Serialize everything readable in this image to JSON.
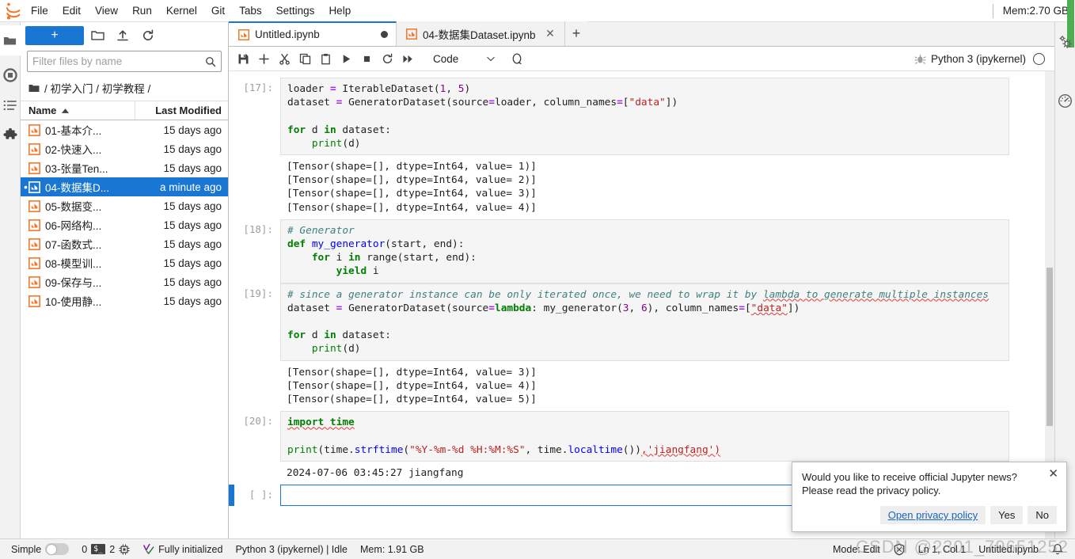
{
  "menu": {
    "logo_icon": "jupyter-logo-icon",
    "items": [
      "File",
      "Edit",
      "View",
      "Run",
      "Kernel",
      "Git",
      "Tabs",
      "Settings",
      "Help"
    ],
    "memory": "Mem:2.70 GB"
  },
  "activitybar": {
    "items": [
      {
        "name": "file-browser",
        "icon": "folder-icon",
        "active": true
      },
      {
        "name": "running-terminals-kernels",
        "icon": "stop-circle-icon",
        "active": false
      },
      {
        "name": "table-of-contents",
        "icon": "list-icon",
        "active": false
      },
      {
        "name": "extension-manager",
        "icon": "puzzle-icon",
        "active": false
      }
    ]
  },
  "rightbar": {
    "items": [
      {
        "name": "property-inspector",
        "icon": "gears-icon"
      },
      {
        "name": "debugger",
        "icon": "gauge-icon"
      }
    ]
  },
  "filebrowser": {
    "new_launcher_label": "+",
    "toolbar_icons": [
      "new-folder-icon",
      "upload-icon",
      "refresh-icon"
    ],
    "filter_placeholder": "Filter files by name",
    "filter_value": "",
    "search_icon": "search-icon",
    "breadcrumb": [
      "/",
      "初学入门",
      "/",
      "初学教程",
      "/"
    ],
    "breadcrumb_text": "/ 初学入门 / 初学教程 /",
    "columns": {
      "name": "Name",
      "modified": "Last Modified"
    },
    "sort_icon": "sort-ascending-icon",
    "files": [
      {
        "name": "01-基本介...",
        "modified": "15 days ago",
        "selected": false,
        "running": false
      },
      {
        "name": "02-快速入...",
        "modified": "15 days ago",
        "selected": false,
        "running": false
      },
      {
        "name": "03-张量Ten...",
        "modified": "15 days ago",
        "selected": false,
        "running": false
      },
      {
        "name": "04-数据集D...",
        "modified": "a minute ago",
        "selected": true,
        "running": true
      },
      {
        "name": "05-数据变...",
        "modified": "15 days ago",
        "selected": false,
        "running": false
      },
      {
        "name": "06-网络构...",
        "modified": "15 days ago",
        "selected": false,
        "running": false
      },
      {
        "name": "07-函数式...",
        "modified": "15 days ago",
        "selected": false,
        "running": false
      },
      {
        "name": "08-模型训...",
        "modified": "15 days ago",
        "selected": false,
        "running": false
      },
      {
        "name": "09-保存与...",
        "modified": "15 days ago",
        "selected": false,
        "running": false
      },
      {
        "name": "10-使用静...",
        "modified": "15 days ago",
        "selected": false,
        "running": false
      }
    ]
  },
  "tabs": [
    {
      "label": "Untitled.ipynb",
      "active": true,
      "dirty": true,
      "icon": "notebook-icon"
    },
    {
      "label": "04-数据集Dataset.ipynb",
      "active": false,
      "dirty": false,
      "icon": "notebook-icon",
      "close_icon": "close-icon"
    }
  ],
  "tab_add_label": "+",
  "notebook_toolbar": {
    "buttons": [
      {
        "name": "save-button",
        "icon": "save-icon"
      },
      {
        "name": "insert-cell-button",
        "icon": "plus-icon"
      },
      {
        "name": "cut-cell-button",
        "icon": "scissors-icon"
      },
      {
        "name": "copy-cell-button",
        "icon": "copy-icon"
      },
      {
        "name": "paste-cell-button",
        "icon": "paste-icon"
      },
      {
        "name": "run-cell-button",
        "icon": "play-icon"
      },
      {
        "name": "interrupt-kernel-button",
        "icon": "stop-square-icon"
      },
      {
        "name": "restart-kernel-button",
        "icon": "restart-icon"
      },
      {
        "name": "restart-run-all-button",
        "icon": "fast-forward-icon"
      }
    ],
    "cell_type": "Code",
    "cell_type_chevron": "chevron-down-icon",
    "loop_icon": "loop-icon",
    "debug_icon": "bug-icon",
    "kernel_name": "Python 3 (ipykernel)",
    "kernel_status_icon": "kernel-idle-circle-icon"
  },
  "cells": [
    {
      "prompt": "[17]:",
      "active": false,
      "code_lines": [
        [
          {
            "t": "loader ",
            "c": ""
          },
          {
            "t": "= ",
            "c": "tok-op"
          },
          {
            "t": "IterableDataset(",
            "c": ""
          },
          {
            "t": "1",
            "c": "tok-num"
          },
          {
            "t": ", ",
            "c": ""
          },
          {
            "t": "5",
            "c": "tok-num"
          },
          {
            "t": ")",
            "c": ""
          }
        ],
        [
          {
            "t": "dataset ",
            "c": ""
          },
          {
            "t": "= ",
            "c": "tok-op"
          },
          {
            "t": "GeneratorDataset(source",
            "c": ""
          },
          {
            "t": "=",
            "c": "tok-op"
          },
          {
            "t": "loader, column_names",
            "c": ""
          },
          {
            "t": "=",
            "c": "tok-op"
          },
          {
            "t": "[",
            "c": ""
          },
          {
            "t": "\"data\"",
            "c": "tok-str"
          },
          {
            "t": "])",
            "c": ""
          }
        ],
        [],
        [
          {
            "t": "for ",
            "c": "tok-kw"
          },
          {
            "t": "d ",
            "c": ""
          },
          {
            "t": "in ",
            "c": "tok-kw"
          },
          {
            "t": "dataset:",
            "c": ""
          }
        ],
        [
          {
            "t": "    ",
            "c": ""
          },
          {
            "t": "print",
            "c": "tok-bi"
          },
          {
            "t": "(d)",
            "c": ""
          }
        ]
      ],
      "output_lines": [
        "[Tensor(shape=[], dtype=Int64, value= 1)]",
        "[Tensor(shape=[], dtype=Int64, value= 2)]",
        "[Tensor(shape=[], dtype=Int64, value= 3)]",
        "[Tensor(shape=[], dtype=Int64, value= 4)]"
      ]
    },
    {
      "prompt": "[18]:",
      "active": false,
      "code_lines": [
        [
          {
            "t": "# Generator",
            "c": "tok-cm"
          }
        ],
        [
          {
            "t": "def ",
            "c": "tok-def"
          },
          {
            "t": "my_generator",
            "c": "tok-fn"
          },
          {
            "t": "(start, end):",
            "c": ""
          }
        ],
        [
          {
            "t": "    ",
            "c": ""
          },
          {
            "t": "for ",
            "c": "tok-kw"
          },
          {
            "t": "i ",
            "c": ""
          },
          {
            "t": "in ",
            "c": "tok-kw"
          },
          {
            "t": "range(start, end):",
            "c": ""
          }
        ],
        [
          {
            "t": "        ",
            "c": ""
          },
          {
            "t": "yield ",
            "c": "tok-kw"
          },
          {
            "t": "i",
            "c": ""
          }
        ]
      ],
      "output_lines": []
    },
    {
      "prompt": "[19]:",
      "active": false,
      "code_lines": [
        [
          {
            "t": "# since a generator instance can be only iterated once, we need to wrap it by ",
            "c": "tok-cm"
          },
          {
            "t": "lambda to generate multiple instances",
            "c": "tok-cm sp"
          }
        ],
        [
          {
            "t": "dataset ",
            "c": ""
          },
          {
            "t": "= ",
            "c": "tok-op"
          },
          {
            "t": "GeneratorDataset(source",
            "c": ""
          },
          {
            "t": "=",
            "c": "tok-op"
          },
          {
            "t": "lambda",
            "c": "tok-kw"
          },
          {
            "t": ": my_generator(",
            "c": ""
          },
          {
            "t": "3",
            "c": "tok-num"
          },
          {
            "t": ", ",
            "c": ""
          },
          {
            "t": "6",
            "c": "tok-num"
          },
          {
            "t": "), column_names",
            "c": ""
          },
          {
            "t": "=",
            "c": "tok-op"
          },
          {
            "t": "[",
            "c": ""
          },
          {
            "t": "\"data\"",
            "c": "tok-str sp"
          },
          {
            "t": "])",
            "c": ""
          }
        ],
        [],
        [
          {
            "t": "for ",
            "c": "tok-kw"
          },
          {
            "t": "d ",
            "c": ""
          },
          {
            "t": "in ",
            "c": "tok-kw"
          },
          {
            "t": "dataset:",
            "c": ""
          }
        ],
        [
          {
            "t": "    ",
            "c": ""
          },
          {
            "t": "print",
            "c": "tok-bi"
          },
          {
            "t": "(d)",
            "c": ""
          }
        ]
      ],
      "output_lines": [
        "[Tensor(shape=[], dtype=Int64, value= 3)]",
        "[Tensor(shape=[], dtype=Int64, value= 4)]",
        "[Tensor(shape=[], dtype=Int64, value= 5)]"
      ]
    },
    {
      "prompt": "[20]:",
      "active": false,
      "code_lines": [
        [
          {
            "t": "import time",
            "c": "tok-kw sp"
          }
        ],
        [],
        [
          {
            "t": "print",
            "c": "tok-bi"
          },
          {
            "t": "(time.",
            "c": ""
          },
          {
            "t": "strftime",
            "c": "tok-fn"
          },
          {
            "t": "(",
            "c": ""
          },
          {
            "t": "\"%Y-%m-%d %H:%M:%S\"",
            "c": "tok-str"
          },
          {
            "t": ", time.",
            "c": ""
          },
          {
            "t": "localtime",
            "c": "tok-fn"
          },
          {
            "t": "())",
            "c": ""
          },
          {
            "t": ",'jiangfang')",
            "c": "tok-str sp"
          }
        ]
      ],
      "output_lines": [
        "2024-07-06 03:45:27 jiangfang"
      ]
    },
    {
      "prompt": "[ ]:",
      "active": true,
      "code_lines": [
        []
      ],
      "output_lines": []
    }
  ],
  "notification": {
    "line1": "Would you like to receive official Jupyter news?",
    "line2": "Please read the privacy policy.",
    "close_icon": "close-icon",
    "buttons": [
      {
        "label": "Open privacy policy",
        "style": "link"
      },
      {
        "label": "Yes",
        "style": "normal"
      },
      {
        "label": "No",
        "style": "normal"
      }
    ]
  },
  "statusbar": {
    "simple_label": "Simple",
    "simple_on": false,
    "kernel_count": "0",
    "terminal_badge": "$_",
    "terminal_count": "2",
    "cpu_icon": "cpu-icon",
    "init_icon": "check-status-icon",
    "init_text": "Fully initialized",
    "kernel_status": "Python 3 (ipykernel) | Idle",
    "memory": "Mem: 1.91 GB",
    "mode": "Mode: Edit",
    "shield_icon": "shield-off-icon",
    "cursor_position": "Ln 1, Col 1",
    "filename": "Untitled.ipynb",
    "bell_icon": "bell-icon"
  },
  "watermark": "CSDN @2301_79651252"
}
